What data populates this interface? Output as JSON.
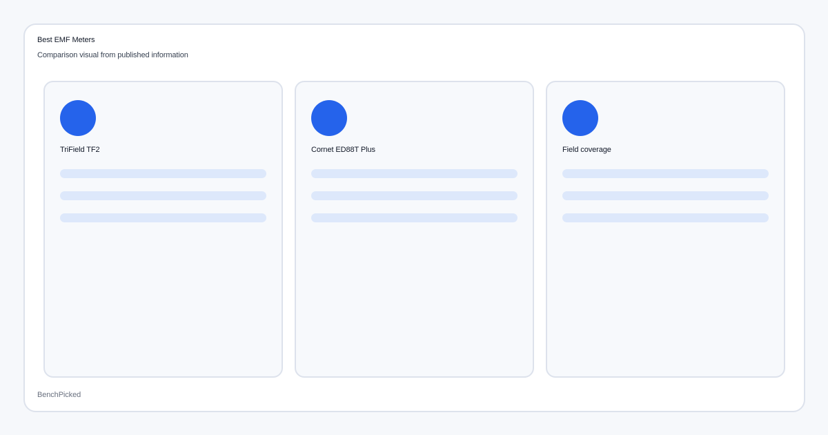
{
  "header": {
    "title": "Best EMF Meters",
    "subtitle": "Comparison visual from published information"
  },
  "cards": [
    {
      "label": "TriField TF2"
    },
    {
      "label": "Cornet ED88T Plus"
    },
    {
      "label": "Field coverage"
    }
  ],
  "footer": {
    "brand": "BenchPicked"
  },
  "colors": {
    "accent": "#2563eb",
    "placeholder_bar": "#dde8fb",
    "card_background": "#f7f9fc",
    "border": "#dde2ec"
  }
}
